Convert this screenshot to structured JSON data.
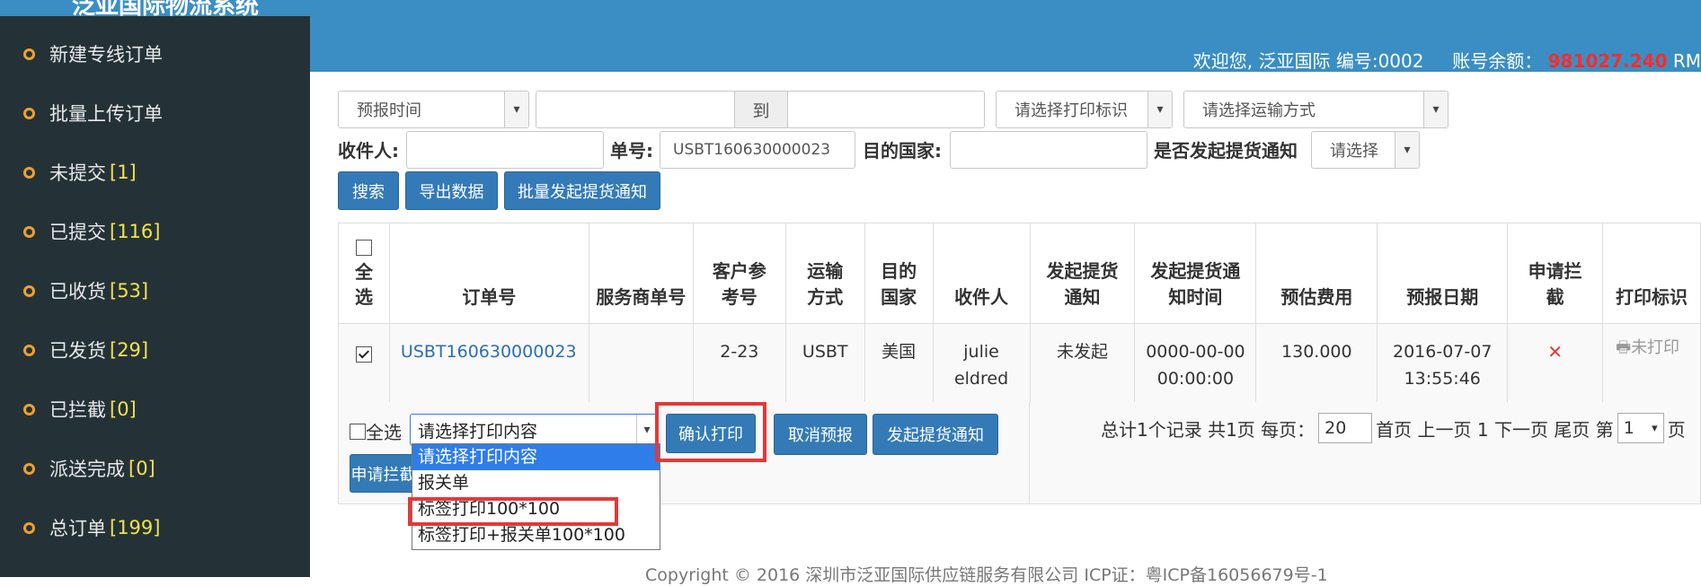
{
  "sidebar": {
    "brand": "泛亚国际物流系统",
    "items": [
      {
        "label": "新建专线订单",
        "count": ""
      },
      {
        "label": "批量上传订单",
        "count": ""
      },
      {
        "label": "未提交",
        "count": "[1]"
      },
      {
        "label": "已提交",
        "count": "[116]"
      },
      {
        "label": "已收货",
        "count": "[53]"
      },
      {
        "label": "已发货",
        "count": "[29]"
      },
      {
        "label": "已拦截",
        "count": "[0]"
      },
      {
        "label": "派送完成",
        "count": "[0]"
      },
      {
        "label": "总订单",
        "count": "[199]"
      }
    ]
  },
  "header": {
    "welcome": "欢迎您, 泛亚国际 编号:0002",
    "balance_label": "账号余额：",
    "balance_value": "981027.240",
    "currency": "RM"
  },
  "filters": {
    "time_type": "预报时间",
    "date_to": "到",
    "print_flag": "请选择打印标识",
    "transport": "请选择运输方式",
    "recipient_label": "收件人:",
    "order_no_label": "单号:",
    "order_no_value": "USBT160630000023",
    "country_label": "目的国家:",
    "notice_label": "是否发起提货通知",
    "notice_select": "请选择"
  },
  "actions": {
    "search": "搜索",
    "export": "导出数据",
    "batch_notice": "批量发起提货通知"
  },
  "table": {
    "headers": [
      "全选",
      "订单号",
      "服务商单号",
      "客户参考号",
      "运输方式",
      "目的国家",
      "收件人",
      "发起提货通知",
      "发起提货通知时间",
      "预估费用",
      "预报日期",
      "申请拦截",
      "打印标识"
    ],
    "rows": [
      {
        "order_no": "USBT160630000023",
        "provider_no": "",
        "customer_ref": "2-23",
        "transport": "USBT",
        "country": "美国",
        "recipient_line1": "julie",
        "recipient_line2": "eldred",
        "notice": "未发起",
        "notice_time_line1": "0000-00-00",
        "notice_time_line2": "00:00:00",
        "fee": "130.000",
        "date_line1": "2016-07-07",
        "date_line2": "13:55:46",
        "intercept": "✕",
        "print_flag": "未打印"
      }
    ]
  },
  "bottom": {
    "select_all": "全选",
    "print_select": "请选择打印内容",
    "confirm_print": "确认打印",
    "cancel_forecast": "取消预报",
    "pickup_notice": "发起提货通知",
    "apply_intercept": "申请拦截",
    "print_options": [
      "请选择打印内容",
      "报关单",
      "标签打印100*100",
      "标签打印+报关单100*100"
    ]
  },
  "pager": {
    "summary": "总计1个记录 共1页 每页：",
    "per_page": "20",
    "nav": "首页 上一页 1 下一页 尾页 第",
    "page": "1",
    "suffix": "页"
  },
  "footer": "Copyright © 2016 深圳市泛亚国际供应链服务有限公司 ICP证：粤ICP备16056679号-1",
  "colors": {
    "sidebar": "#243238",
    "header": "#3a8ec3",
    "button": "#337ab7",
    "highlight": "#e53838",
    "balance": "#ff2a2a"
  }
}
